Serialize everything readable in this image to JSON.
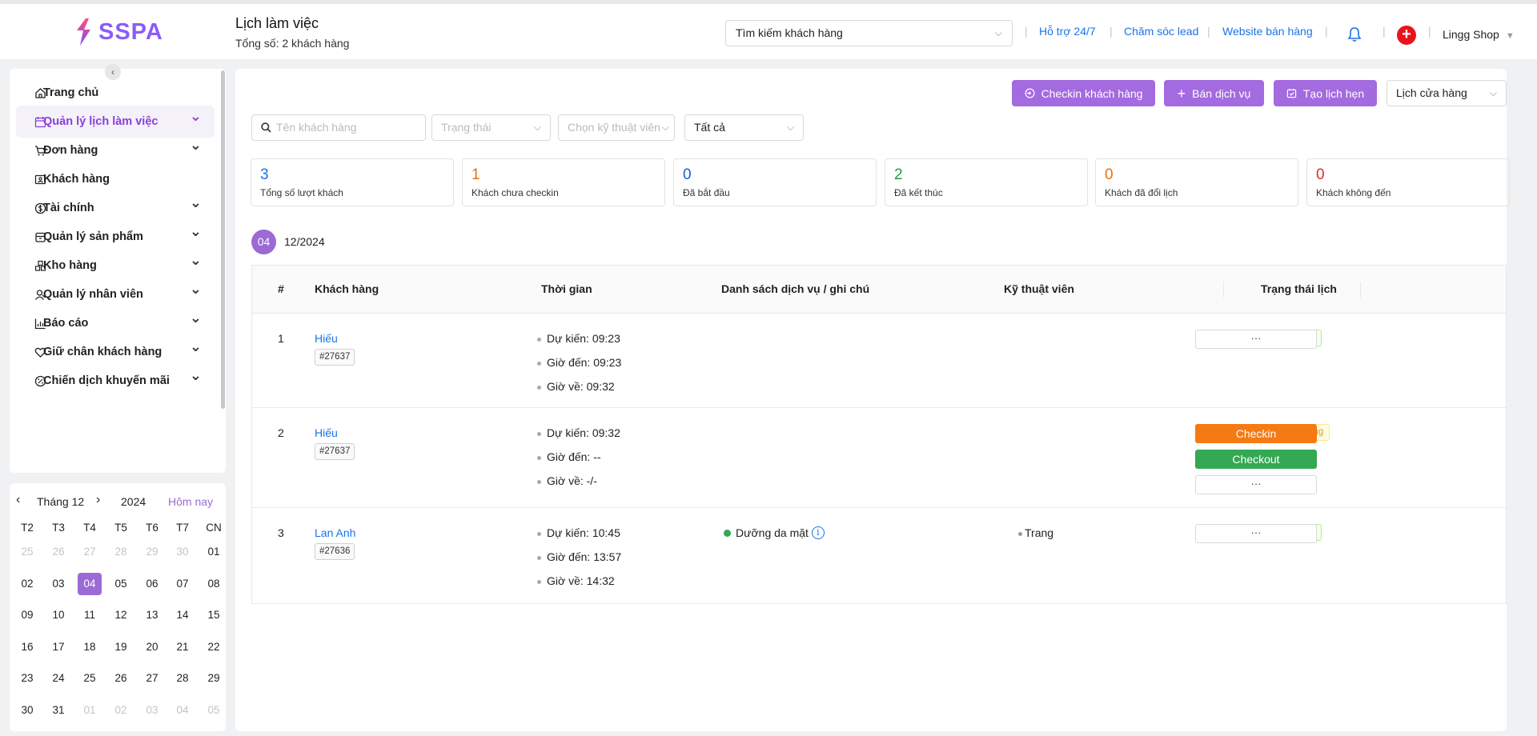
{
  "header": {
    "brand": "SSPA",
    "page_title": "Lịch làm việc",
    "page_subtitle": "Tổng số: 2 khách hàng",
    "search_placeholder": "Tìm kiếm khách hàng",
    "links": [
      "Hỗ trợ 24/7",
      "Chăm sóc lead",
      "Website bán hàng"
    ],
    "separator": "|",
    "shop_name": "Lingg Shop"
  },
  "sidebar": {
    "items": [
      {
        "label": "Trang chủ",
        "icon": "home-icon",
        "has_children": false
      },
      {
        "label": "Quản lý lịch làm việc",
        "icon": "calendar-icon",
        "has_children": true,
        "active": true
      },
      {
        "label": "Đơn hàng",
        "icon": "cart-icon",
        "has_children": true
      },
      {
        "label": "Khách hàng",
        "icon": "contact-card-icon",
        "has_children": false
      },
      {
        "label": "Tài chính",
        "icon": "dollar-circle-icon",
        "has_children": true
      },
      {
        "label": "Quản lý sản phẩm",
        "icon": "box-icon",
        "has_children": true
      },
      {
        "label": "Kho hàng",
        "icon": "warehouse-icon",
        "has_children": true
      },
      {
        "label": "Quản lý nhân viên",
        "icon": "user-icon",
        "has_children": true
      },
      {
        "label": "Báo cáo",
        "icon": "bar-chart-icon",
        "has_children": true
      },
      {
        "label": "Giữ chân khách hàng",
        "icon": "heart-icon",
        "has_children": true
      },
      {
        "label": "Chiến dịch khuyến mãi",
        "icon": "percent-icon",
        "has_children": true
      }
    ]
  },
  "calendar": {
    "month_label": "Tháng 12",
    "year_label": "2024",
    "today_label": "Hôm nay",
    "weekdays": [
      "T2",
      "T3",
      "T4",
      "T5",
      "T6",
      "T7",
      "CN"
    ],
    "selected": "04",
    "weeks": [
      [
        "25",
        "26",
        "27",
        "28",
        "29",
        "30",
        "01"
      ],
      [
        "02",
        "03",
        "04",
        "05",
        "06",
        "07",
        "08"
      ],
      [
        "09",
        "10",
        "11",
        "12",
        "13",
        "14",
        "15"
      ],
      [
        "16",
        "17",
        "18",
        "19",
        "20",
        "21",
        "22"
      ],
      [
        "23",
        "24",
        "25",
        "26",
        "27",
        "28",
        "29"
      ],
      [
        "30",
        "31",
        "01",
        "02",
        "03",
        "04",
        "05"
      ]
    ]
  },
  "toolbar": {
    "checkin_label": "Checkin khách hàng",
    "sell_label": "Bán dịch vụ",
    "booking_label": "Tạo lịch hẹn",
    "store_calendar_label": "Lịch cửa hàng"
  },
  "filters": {
    "customer_placeholder": "Tên khách hàng",
    "status_placeholder": "Trạng thái",
    "technician_placeholder": "Chọn kỹ thuật viên",
    "scope_value": "Tất cả"
  },
  "stats": [
    {
      "value": "3",
      "label": "Tổng số lượt khách",
      "color": "#1a73e8"
    },
    {
      "value": "1",
      "label": "Khách chưa checkin",
      "color": "#e8710a"
    },
    {
      "value": "0",
      "label": "Đã bắt đầu",
      "color": "#1a5fd6"
    },
    {
      "value": "2",
      "label": "Đã kết thúc",
      "color": "#1e9e4a"
    },
    {
      "value": "0",
      "label": "Khách đã đổi lịch",
      "color": "#e8710a"
    },
    {
      "value": "0",
      "label": "Khách không đến",
      "color": "#d93025"
    }
  ],
  "date_group": {
    "day": "04",
    "month_year": "12/2024"
  },
  "table": {
    "columns": [
      "#",
      "Khách hàng",
      "Thời gian",
      "Danh sách dịch vụ / ghi chú",
      "Kỹ thuật viên",
      "Trạng thái lịch"
    ],
    "time_labels": {
      "expected": "Dự kiến:",
      "arrival": "Giờ đến:",
      "leave": "Giờ về:"
    },
    "more_label": "···",
    "checkin_label": "Checkin",
    "checkout_label": "Checkout",
    "rows": [
      {
        "index": "1",
        "name": "Hiếu",
        "code": "#27637",
        "expected": "09:23",
        "arrival": "09:23",
        "leave": "09:32",
        "service": "",
        "technician": "",
        "status": "Đã kết thúc"
      },
      {
        "index": "2",
        "name": "Hiếu",
        "code": "#27637",
        "expected": "09:32",
        "arrival": "--",
        "leave": "-/-",
        "service": "",
        "technician": "",
        "status": "Chưa sử dụng"
      },
      {
        "index": "3",
        "name": "Lan Anh",
        "code": "#27636",
        "expected": "10:45",
        "arrival": "13:57",
        "leave": "14:32",
        "service": "Dưỡng da mặt",
        "technician": "Trang",
        "status": "Đã kết thúc"
      }
    ]
  },
  "colors": {
    "accent": "#a46ae0",
    "link": "#1a73e8",
    "checkin": "#f57a14",
    "checkout": "#34a853"
  }
}
